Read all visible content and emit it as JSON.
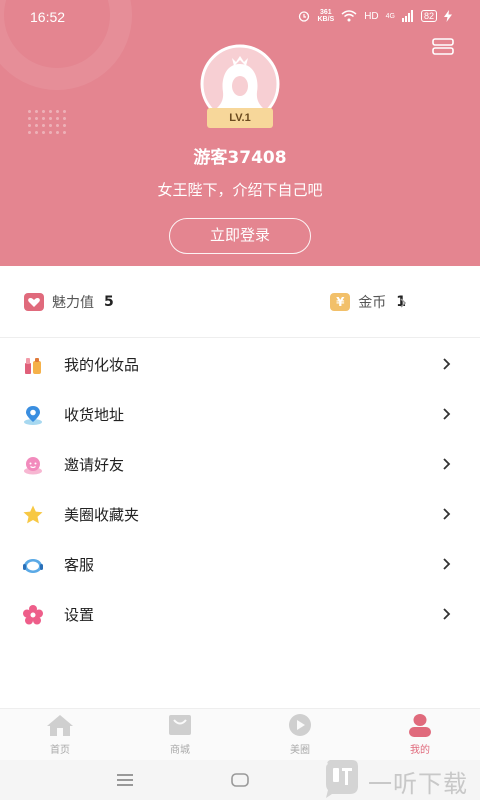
{
  "status_bar": {
    "time": "16:52",
    "net_speed_top": "361",
    "net_speed_bottom": "KB/S",
    "hd": "HD",
    "signal": "4G",
    "battery": "82"
  },
  "profile": {
    "level": "LV.1",
    "username": "游客37408",
    "tagline": "女王陛下，介绍下自己吧",
    "login_label": "立即登录"
  },
  "stats": {
    "charm_label": "魅力值",
    "charm_value": "5",
    "coin_icon_glyph": "¥",
    "coin_label": "金币",
    "coin_value": "1"
  },
  "menu": {
    "items": [
      {
        "label": "我的化妆品",
        "icon": "cosmetics-icon"
      },
      {
        "label": "收货地址",
        "icon": "location-icon"
      },
      {
        "label": "邀请好友",
        "icon": "invite-icon"
      },
      {
        "label": "美圈收藏夹",
        "icon": "star-icon"
      },
      {
        "label": "客服",
        "icon": "headset-icon"
      },
      {
        "label": "设置",
        "icon": "gear-icon"
      }
    ]
  },
  "tabbar": {
    "tabs": [
      {
        "label": "首页",
        "icon": "home-icon"
      },
      {
        "label": "商城",
        "icon": "shop-icon"
      },
      {
        "label": "美圈",
        "icon": "play-icon"
      },
      {
        "label": "我的",
        "icon": "user-icon"
      }
    ]
  },
  "watermark": {
    "text": "一听下载"
  },
  "colors": {
    "header_bg": "#e48590",
    "accent": "#e06a7c",
    "coin": "#f2c06a"
  }
}
